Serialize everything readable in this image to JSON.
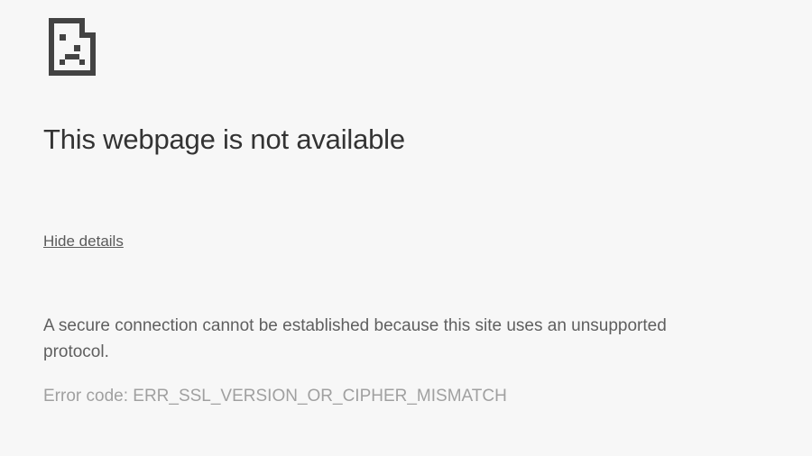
{
  "heading": "This webpage is not available",
  "toggle_details": "Hide details",
  "description": "A secure connection cannot be established because this site uses an unsupported protocol.",
  "error_code_label": "Error code: ",
  "error_code_value": "ERR_SSL_VERSION_OR_CIPHER_MISMATCH"
}
